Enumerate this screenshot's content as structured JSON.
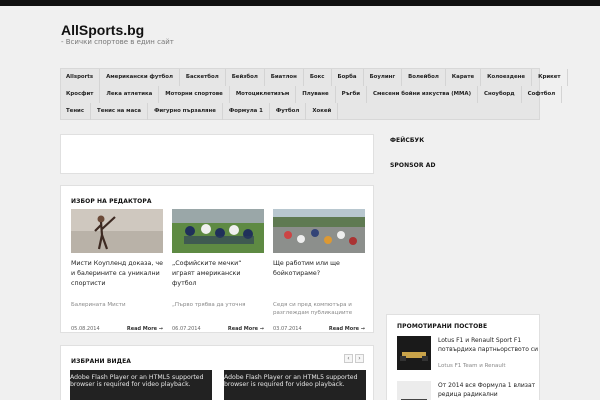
{
  "site": {
    "logo": "AllSports.bg",
    "tagline": "- Всички спортове в един сайт"
  },
  "nav": {
    "row1": [
      "Allsports",
      "Американски футбол",
      "Баскетбол",
      "Бейзбол",
      "Биатлон",
      "Бокс",
      "Борба",
      "Боулинг",
      "Волейбол",
      "Карате",
      "Колоездене",
      "Крикет"
    ],
    "row2": [
      "Кросфит",
      "Лека атлетика",
      "Моторни спортове",
      "Мотоциклетизъм",
      "Плуване",
      "Ръгби",
      "Смесени бойни изкуства (MMA)",
      "Сноуборд",
      "Софтбол"
    ],
    "row3": [
      "Тенис",
      "Тенис на маса",
      "Фигурно пързаляне",
      "Формула 1",
      "Футбол",
      "Хокей"
    ]
  },
  "editors": {
    "title": "ИЗБОР НА РЕДАКТОРА",
    "more_label": "Read More →",
    "cards": [
      {
        "title": "Мисти Коупленд доказа, че и балерините са уникални спортисти",
        "excerpt": "Балерината Мисти",
        "date": "05.08.2014",
        "thumb": "ballerina-photo"
      },
      {
        "title": "„Софийските мечки“ играят американски футбол",
        "excerpt": "„Първо трябва да уточня",
        "date": "06.07.2014",
        "thumb": "football-photo"
      },
      {
        "title": "Ще работим или ще бойкотираме?",
        "excerpt": "Седя си пред компютъра и разглеждам публикациите",
        "date": "03.07.2014",
        "thumb": "crowd-photo"
      }
    ]
  },
  "sidebar": {
    "facebook": "ФЕЙСБУК",
    "sponsor": "SPONSOR AD",
    "promoted_title": "ПРОМОТИРАНИ ПОСТОВЕ",
    "promoted": [
      {
        "text": "Lotus F1 и Renault Sport F1 потвърдиха партньорството си",
        "sub": "Lotus F1 Team и Renault"
      },
      {
        "text": "От 2014 вся Формула 1 влизат редица радикални",
        "sub": ""
      }
    ]
  },
  "videos": {
    "title": "ИЗБРАНИ ВИДЕА",
    "prev": "‹",
    "next": "›",
    "items": [
      {
        "line1": "Adobe Flash Player or an HTML5 supported",
        "line2": "browser is required for video playback."
      },
      {
        "line1": "Adobe Flash Player or an HTML5 supported",
        "line2": "browser is required for video playback."
      }
    ]
  },
  "colors": {
    "background": "#f0f0f0",
    "nav": "#e6e6e6",
    "text": "#222222",
    "topbar": "#111111"
  }
}
